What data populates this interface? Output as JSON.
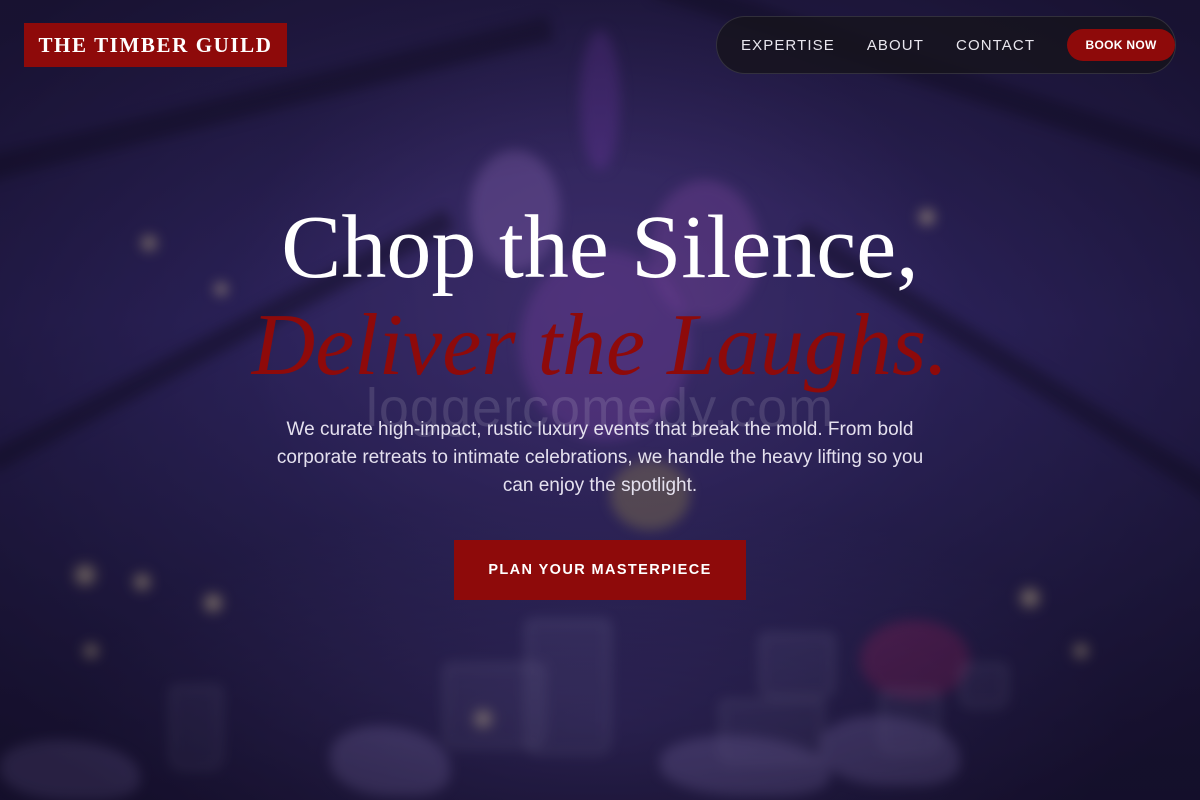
{
  "brand": {
    "name": "THE TIMBER GUILD"
  },
  "nav": {
    "links": [
      "EXPERTISE",
      "ABOUT",
      "CONTACT"
    ],
    "cta_label": "BOOK NOW"
  },
  "hero": {
    "headline_line1": "Chop the Silence,",
    "headline_line2": "Deliver the Laughs.",
    "watermark": "loggercomedy.com",
    "description": "We curate high-impact, rustic luxury events that break the mold. From bold corporate retreats to intimate celebrations, we handle the heavy lifting so you can enjoy the spotlight.",
    "cta_label": "PLAN YOUR MASTERPIECE"
  },
  "colors": {
    "accent": "#8e0a0a",
    "background": "#2d2358",
    "text": "#ffffff"
  },
  "background_image": "blurred banquet table with purple floral centerpiece and glassware"
}
